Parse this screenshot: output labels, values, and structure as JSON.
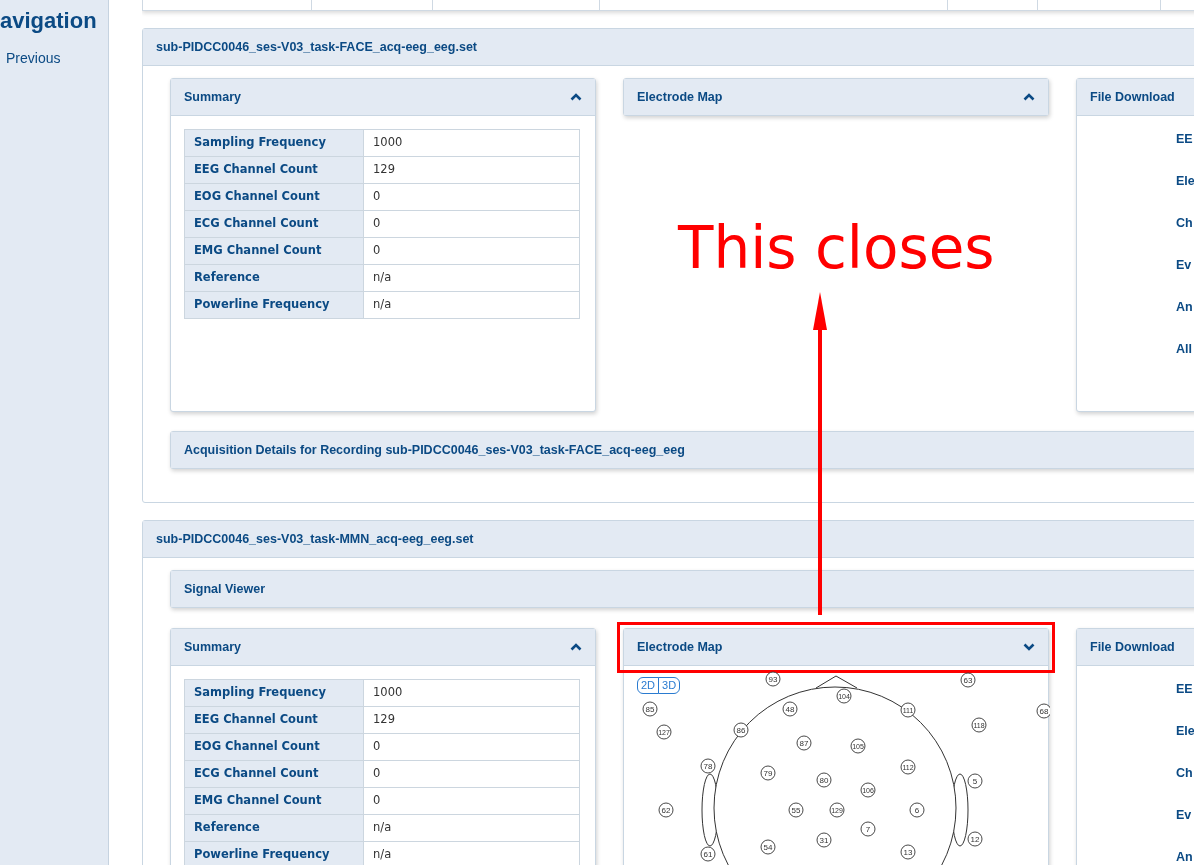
{
  "sidebar": {
    "title": "avigation",
    "links": [
      "Previous"
    ]
  },
  "recordings": [
    {
      "title": "sub-PIDCC0046_ses-V03_task-FACE_acq-eeg_eeg.set",
      "summary": {
        "title": "Summary",
        "chevron_up": true,
        "expanded": true,
        "rows": [
          {
            "label": "Sampling Frequency",
            "value": "1000"
          },
          {
            "label": "EEG Channel Count",
            "value": "129"
          },
          {
            "label": "EOG Channel Count",
            "value": "0"
          },
          {
            "label": "ECG Channel Count",
            "value": "0"
          },
          {
            "label": "EMG Channel Count",
            "value": "0"
          },
          {
            "label": "Reference",
            "value": "n/a"
          },
          {
            "label": "Powerline Frequency",
            "value": "n/a"
          }
        ]
      },
      "electrode_map": {
        "title": "Electrode Map",
        "chevron_up": true,
        "expanded": false,
        "highlighted": false
      },
      "file_download": {
        "title": "File Download",
        "links": [
          "EE",
          "Ele",
          "Ch",
          "Ev",
          "An",
          "All"
        ]
      },
      "acquisition": {
        "title": "Acquisition Details for Recording sub-PIDCC0046_ses-V03_task-FACE_acq-eeg_eeg"
      }
    },
    {
      "title": "sub-PIDCC0046_ses-V03_task-MMN_acq-eeg_eeg.set",
      "signal_viewer": {
        "title": "Signal Viewer"
      },
      "summary": {
        "title": "Summary",
        "chevron_up": true,
        "expanded": true,
        "rows": [
          {
            "label": "Sampling Frequency",
            "value": "1000"
          },
          {
            "label": "EEG Channel Count",
            "value": "129"
          },
          {
            "label": "EOG Channel Count",
            "value": "0"
          },
          {
            "label": "ECG Channel Count",
            "value": "0"
          },
          {
            "label": "EMG Channel Count",
            "value": "0"
          },
          {
            "label": "Reference",
            "value": "n/a"
          },
          {
            "label": "Powerline Frequency",
            "value": "n/a"
          }
        ]
      },
      "electrode_map": {
        "title": "Electrode Map",
        "chevron_up": false,
        "expanded": true,
        "highlighted": true,
        "view_buttons": [
          "2D",
          "3D"
        ],
        "electrodes": [
          "93",
          "104",
          "63",
          "85",
          "48",
          "111",
          "68",
          "118",
          "127",
          "86",
          "87",
          "105",
          "78",
          "79",
          "112",
          "80",
          "5",
          "106",
          "62",
          "55",
          "129",
          "6",
          "7",
          "12",
          "31",
          "54",
          "13",
          "61"
        ]
      },
      "file_download": {
        "title": "File Download",
        "links": [
          "EE",
          "Ele",
          "Ch",
          "Ev",
          "An"
        ]
      }
    }
  ],
  "annotation": {
    "text": "This closes"
  }
}
